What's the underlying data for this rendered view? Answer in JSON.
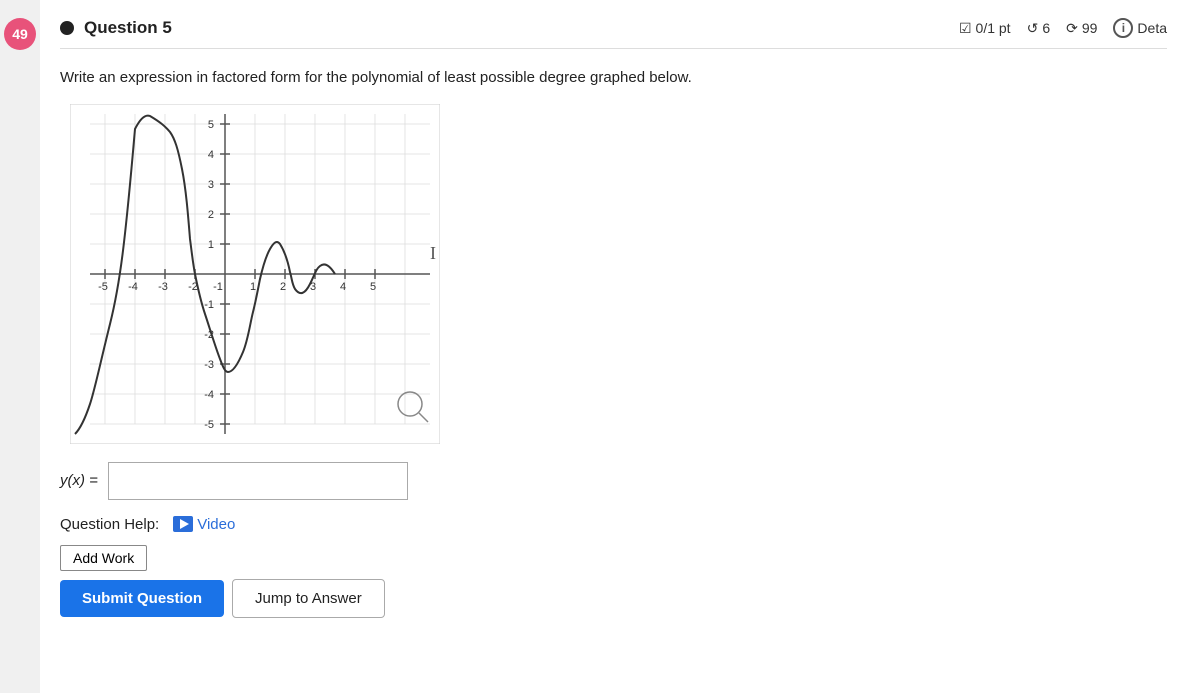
{
  "badge": {
    "number": "49"
  },
  "header": {
    "question_label": "Question 5",
    "score": "0/1 pt",
    "attempts_label": "6",
    "submissions_label": "99",
    "details_label": "Deta"
  },
  "question": {
    "body": "Write an expression in factored form for the polynomial of least possible degree graphed below."
  },
  "answer": {
    "label": "y(x) =",
    "placeholder": ""
  },
  "help": {
    "label": "Question Help:",
    "video_label": "Video"
  },
  "buttons": {
    "add_work": "Add Work",
    "submit": "Submit Question",
    "jump": "Jump to Answer"
  },
  "graph": {
    "x_min": -5,
    "x_max": 5,
    "y_min": -5,
    "y_max": 5
  }
}
